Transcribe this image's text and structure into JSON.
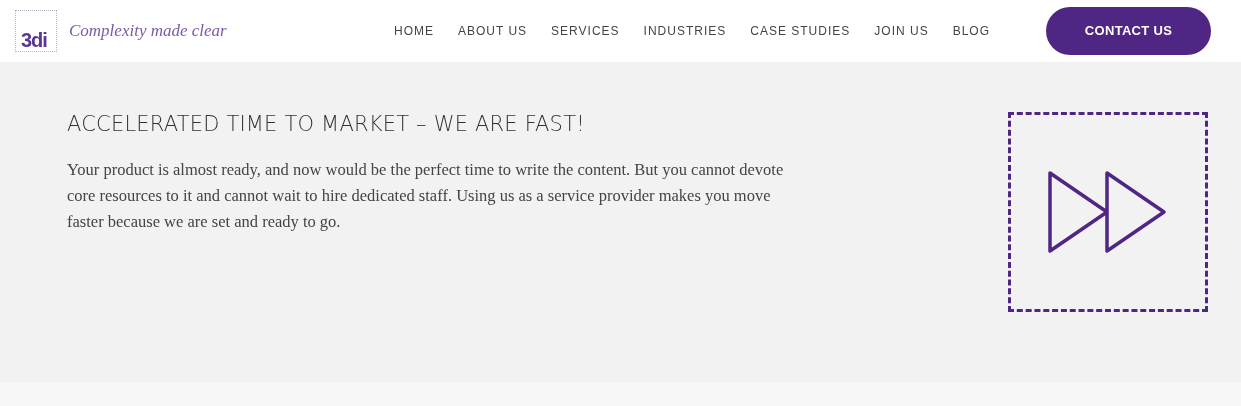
{
  "logo": {
    "mark": "3di",
    "tagline": "Complexity made clear"
  },
  "nav": {
    "items": [
      {
        "label": "HOME"
      },
      {
        "label": "ABOUT US"
      },
      {
        "label": "SERVICES"
      },
      {
        "label": "INDUSTRIES"
      },
      {
        "label": "CASE STUDIES"
      },
      {
        "label": "JOIN US"
      },
      {
        "label": "BLOG"
      }
    ],
    "cta": "CONTACT US"
  },
  "section": {
    "heading": "ACCELERATED TIME TO MARKET – WE ARE FAST!",
    "body": "Your product is almost ready, and now would be the perfect time to write the content. But you cannot devote core resources to it and cannot wait to hire dedicated staff. Using us as a service provider makes you move faster because we are set and ready to go."
  }
}
